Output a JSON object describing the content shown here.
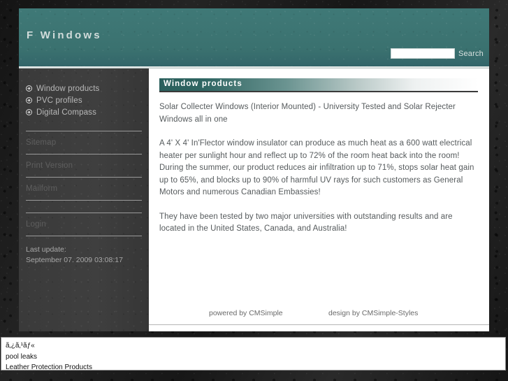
{
  "header": {
    "site_title": "F Windows",
    "search": {
      "value": "",
      "placeholder": "",
      "button_label": "Search"
    }
  },
  "sidebar": {
    "nav_items": [
      {
        "label": "Window products",
        "icon": "circle-arrow-icon"
      },
      {
        "label": "PVC profiles",
        "icon": "circle-arrow-icon"
      },
      {
        "label": "Digital Compass",
        "icon": "circle-arrow-icon"
      }
    ],
    "secondary_items": [
      {
        "label": "Sitemap"
      },
      {
        "label": "Print Version"
      },
      {
        "label": "Mailform"
      },
      {
        "label": "Login"
      }
    ],
    "last_update_label": "Last update:",
    "last_update_value": "September 07. 2009 03:08:17"
  },
  "main": {
    "page_heading": "Window products",
    "paragraphs": [
      "Solar Collecter Windows (Interior Mounted) - University Tested and Solar Rejecter Windows all in one",
      "A 4' X 4' In'Flector window insulator can produce as much heat as a 600 watt electrical heater per sunlight hour and reflect up to 72% of the room heat back into the room!  During the summer, our product reduces air infiltration up to 71%, stops solar heat gain up to 65%, and blocks up to 90% of harmful UV rays for such customers as General Motors and numerous Canadian Embassies!",
      "They have been tested by two major universities with outstanding results and are located in the United States, Canada, and Australia!"
    ],
    "footer": {
      "powered_by": "powered by CMSimple",
      "design_by": "design by CMSimple-Styles"
    }
  },
  "bottom_panel": {
    "links": [
      "ã‚¿ã‚¹ãƒ«",
      "pool leaks",
      "Leather Protection Products"
    ]
  },
  "colors": {
    "header_teal": "#3d7573",
    "heading_dark_teal": "#2a5f5c",
    "sidebar_gray": "#3a3a3a",
    "page_background": "#1b1b1b",
    "content_white": "#ffffff"
  }
}
